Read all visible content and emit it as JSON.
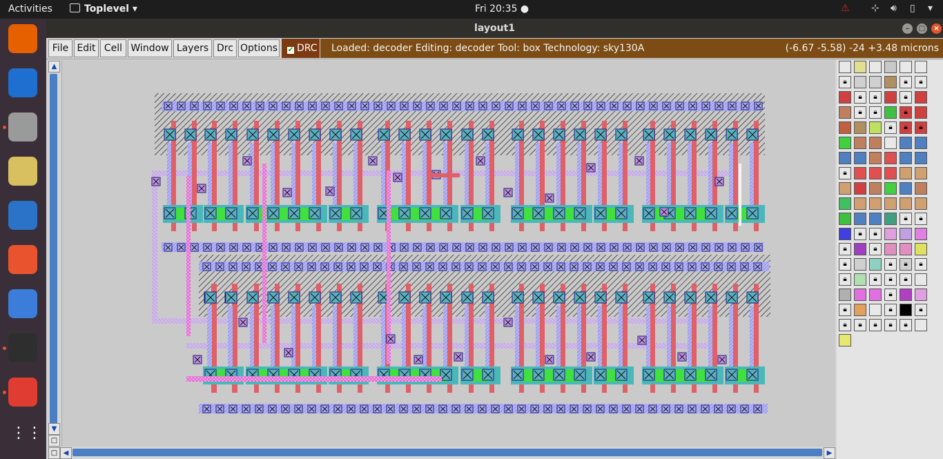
{
  "topbar": {
    "activities": "Activities",
    "app_name": "Toplevel ▾",
    "clock": "Fri 20:35 ●",
    "tray_icons": [
      "warning-icon",
      "network-icon",
      "volume-icon",
      "battery-icon",
      "power-menu-icon"
    ]
  },
  "dock": {
    "apps": [
      {
        "name": "firefox",
        "color": "#e66000",
        "running": false
      },
      {
        "name": "thunderbird",
        "color": "#1f6fd0",
        "running": false
      },
      {
        "name": "files",
        "color": "#9a9a9a",
        "running": true
      },
      {
        "name": "rhythmbox",
        "color": "#d8c060",
        "running": false
      },
      {
        "name": "libreoffice-writer",
        "color": "#2a73c8",
        "running": false
      },
      {
        "name": "software-center",
        "color": "#e9542e",
        "running": false
      },
      {
        "name": "help",
        "color": "#3b7dd8",
        "running": false
      },
      {
        "name": "terminal",
        "color": "#2e2e2e",
        "running": true
      },
      {
        "name": "magic-app",
        "color": "#e03c31",
        "running": true
      }
    ],
    "show_apps": "⋮⋮⋮"
  },
  "window": {
    "title": "layout1",
    "controls": [
      "–",
      "□",
      "×"
    ]
  },
  "menubar": {
    "items": [
      "File",
      "Edit",
      "Cell",
      "Window",
      "Layers",
      "Drc",
      "Options"
    ],
    "drc_label": "DRC",
    "drc_checked": true,
    "status_text": "Loaded: decoder Editing: decoder Tool: box  Technology: sky130A",
    "coords": "(-6.67 -5.58) -24 +3.48 microns"
  },
  "colors": {
    "poly": "#e06068",
    "diff": "#40e040",
    "metal1": "#a8a8f0",
    "li": "#c0a0e8",
    "contact": "#4ab8b8",
    "pink": "#f070d8",
    "hatch": "#222222"
  },
  "layout": {
    "cell": "decoder",
    "rows": 2
  },
  "palette": {
    "swatches": [
      "#e8e8e8",
      "#e0e090",
      "#e8e8e8",
      "#c8c8c8",
      "#e8e8e8",
      "#e8e8e8",
      "#e8e8e8",
      "#d0d0d0",
      "#d0d0d0",
      "#b09060",
      "#e8e8e8",
      "#e8e8e8",
      "#d04040",
      "#e8e8e8",
      "#e8e8e8",
      "#d04040",
      "#e8e8e8",
      "#d04040",
      "#c08060",
      "#e8e8e8",
      "#e8e8e8",
      "#40c040",
      "#d04040",
      "#d04040",
      "#c06040",
      "#b09060",
      "#c0e060",
      "#e8e8e8",
      "#d04040",
      "#d04040",
      "#40d040",
      "#c08060",
      "#c08060",
      "#e8e8e8",
      "#5080c0",
      "#5080c0",
      "#5080c0",
      "#5080c0",
      "#c08060",
      "#e05050",
      "#5080c0",
      "#5080c0",
      "#e8e8e8",
      "#e05050",
      "#e05050",
      "#e05050",
      "#d0a070",
      "#d0a070",
      "#d0a070",
      "#d04040",
      "#c08060",
      "#40d040",
      "#5080c0",
      "#c08060",
      "#40c060",
      "#d0a070",
      "#d0a070",
      "#d0a070",
      "#d0a070",
      "#d0a070",
      "#40c040",
      "#5080c0",
      "#5080c0",
      "#40a080",
      "#e8e8e8",
      "#e8e8e8",
      "#4040e0",
      "#e8e8e8",
      "#e8e8e8",
      "#e0a0e0",
      "#c0a0e0",
      "#e080e0",
      "#e8e8e8",
      "#a040c0",
      "#e8e8e8",
      "#e090c0",
      "#e090c0",
      "#e0e060",
      "#e8e8e8",
      "#d0d0d0",
      "#90d0c0",
      "#e8e8e8",
      "#d0d0d0",
      "#e8e8e8",
      "#e8e8e8",
      "#b0e0b0",
      "#e8e8e8",
      "#e8e8e8",
      "#e8e8e8",
      "#e8e8e8",
      "#b0b0b0",
      "#e070e0",
      "#e070e0",
      "#e8e8e8",
      "#b040c0",
      "#e0a0e0",
      "#e8e8e8",
      "#e0a060",
      "#e8e8e8",
      "#e8e8e8",
      "#000000",
      "#e8e8e8",
      "#e8e8e8",
      "#e8e8e8",
      "#e8e8e8",
      "#e8e8e8",
      "#e8e8e8",
      "#e8e8e8",
      "#e8e870"
    ],
    "locked": [
      0,
      0,
      0,
      0,
      0,
      0,
      1,
      0,
      0,
      0,
      1,
      1,
      0,
      1,
      1,
      0,
      1,
      0,
      0,
      1,
      1,
      0,
      1,
      0,
      0,
      0,
      0,
      1,
      1,
      1,
      0,
      0,
      0,
      0,
      0,
      0,
      0,
      0,
      0,
      0,
      0,
      0,
      1,
      0,
      0,
      0,
      0,
      0,
      0,
      0,
      0,
      0,
      0,
      0,
      0,
      0,
      0,
      0,
      0,
      0,
      0,
      0,
      0,
      0,
      1,
      1,
      0,
      1,
      1,
      0,
      0,
      0,
      1,
      0,
      1,
      0,
      0,
      0,
      1,
      0,
      0,
      1,
      1,
      1,
      1,
      0,
      1,
      1,
      1,
      0,
      0,
      0,
      0,
      1,
      0,
      0,
      1,
      0,
      0,
      1,
      0,
      1,
      1,
      1,
      1,
      1,
      1,
      0,
      0
    ]
  }
}
